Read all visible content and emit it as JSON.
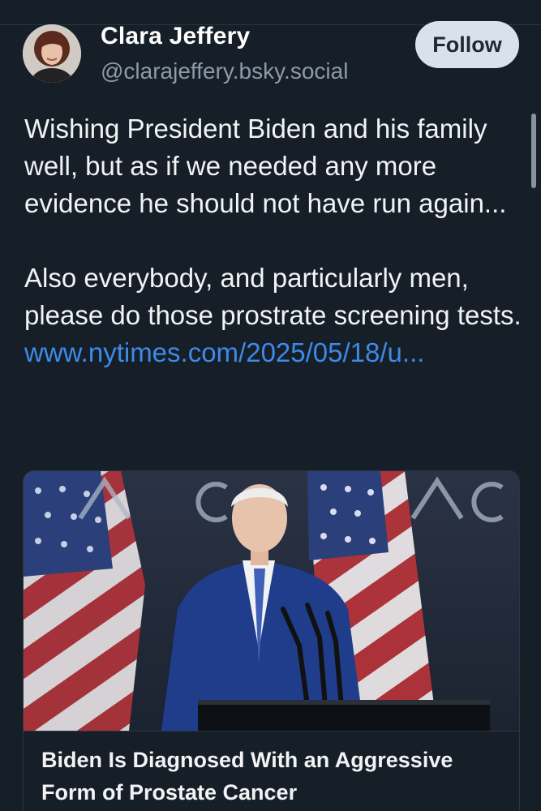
{
  "post": {
    "author": {
      "display_name": "Clara Jeffery",
      "handle": "@clarajeffery.bsky.social",
      "avatar_icon": "avatar-photo"
    },
    "follow_label": "Follow",
    "paragraph_1": "Wishing President Biden and his family well, but as if we needed any more evidence he should not have run again...",
    "paragraph_2_text": "Also everybody, and particularly men, please do those prostrate screening tests.",
    "link_text": "www.nytimes.com/2025/05/18/u...",
    "link_card": {
      "image_alt": "Joe Biden speaking at a podium with microphones, American flags behind him",
      "title": "Biden Is Diagnosed With an Aggressive Form of Prostate Cancer"
    }
  },
  "colors": {
    "background": "#161e27",
    "text": "#f1f3f5",
    "handle": "#8d9aa9",
    "link": "#3d8ae8",
    "follow_button_bg": "#d9e1ea",
    "divider": "#2b3642"
  }
}
